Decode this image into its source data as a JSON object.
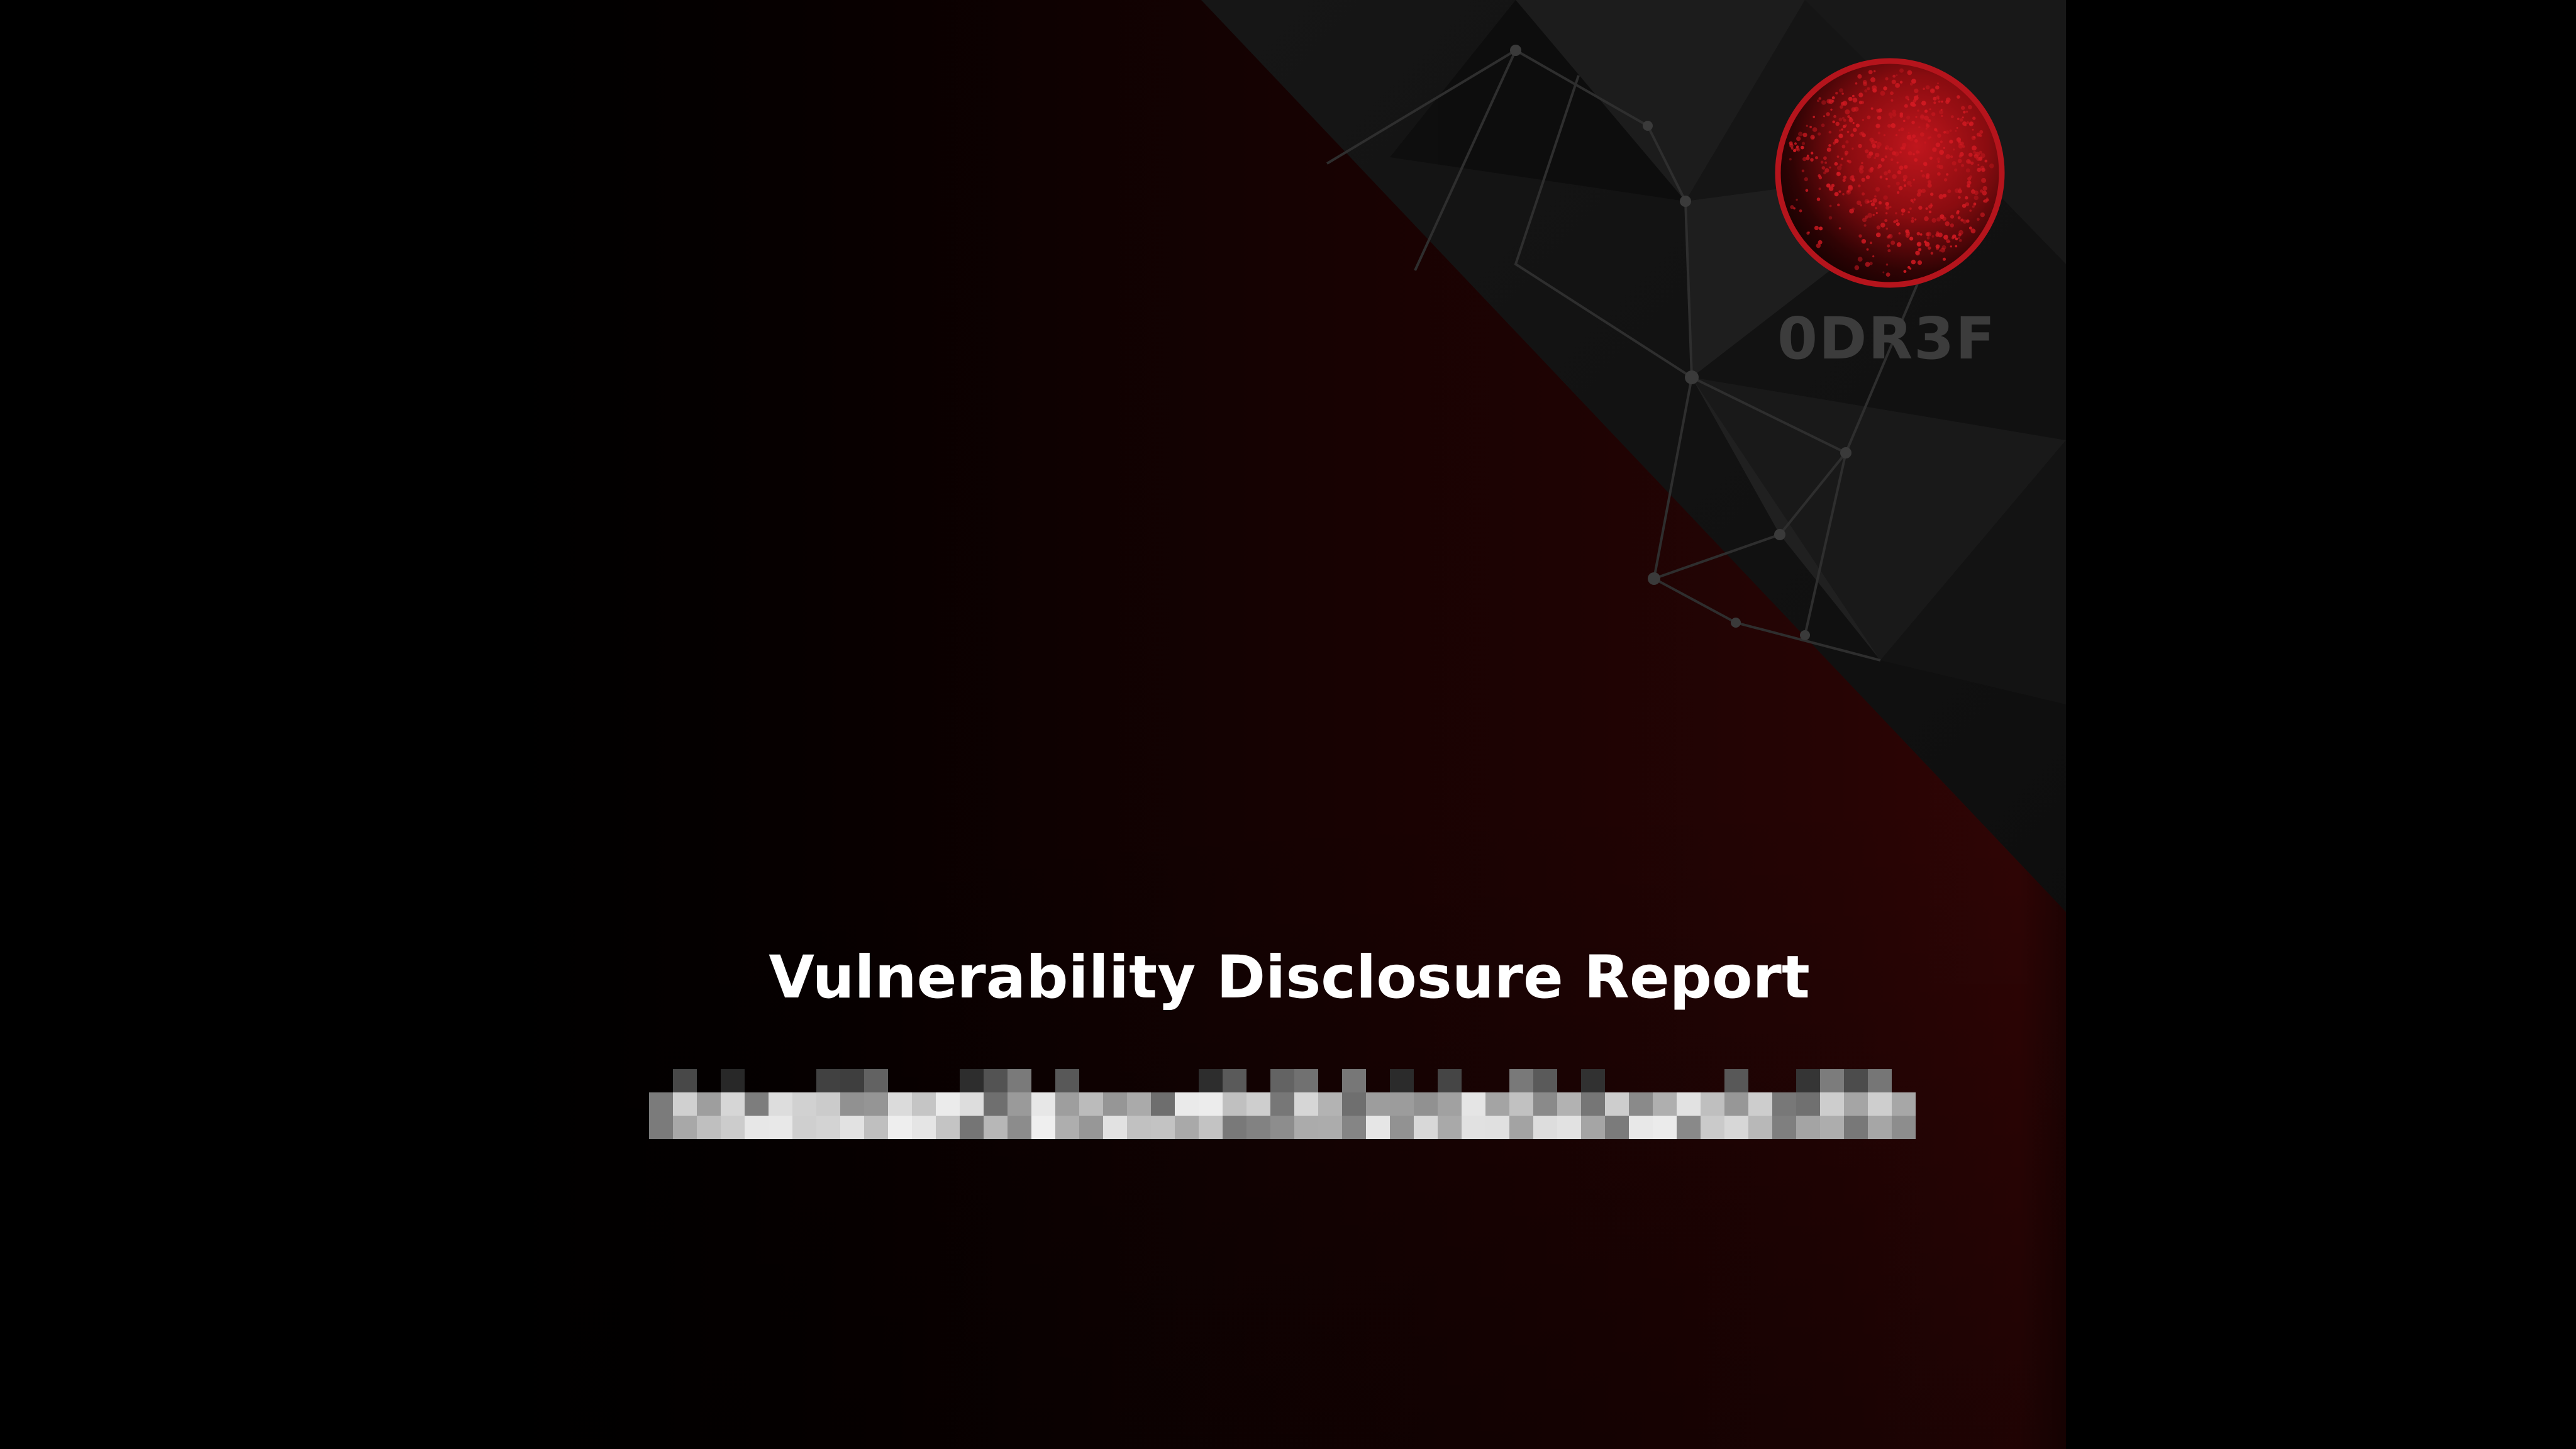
{
  "cover": {
    "title": "Vulnerability Disclosure Report",
    "brand": "0DR3F",
    "subtitle_state": "redacted (pixelated)"
  },
  "colors": {
    "background": "#000000",
    "accent_red": "#b5141c",
    "red_gradient_dark": "#160202",
    "red_gradient_light": "#300505",
    "network_panel": "#1b1b1b",
    "brand_text": "#3c3c3c",
    "title_text": "#ffffff"
  },
  "icons": {
    "seal": "red-stippled-circle-logo",
    "network": "polygon-network-mesh",
    "redaction": "pixelated-redaction-bar"
  }
}
